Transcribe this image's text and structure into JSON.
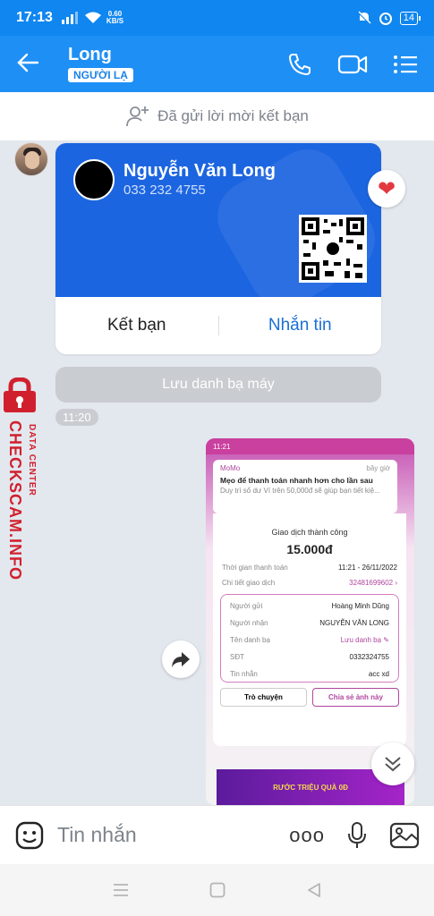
{
  "status": {
    "time": "17:13",
    "speed_value": "0.60",
    "speed_unit": "KB/S",
    "battery": "14"
  },
  "header": {
    "title": "Long",
    "badge": "NGƯỜI LẠ"
  },
  "friend_request": {
    "text": "Đã gửi lời mời kết bạn"
  },
  "contact_card": {
    "name": "Nguyễn Văn Long",
    "phone": "033 232 4755",
    "add_friend_label": "Kết bạn",
    "message_label": "Nhắn tin"
  },
  "save_contact": {
    "label": "Lưu danh bạ máy"
  },
  "message_time": "11:20",
  "watermark": {
    "line1": "DATA CENTER",
    "line2": "CHECKSCAM.INFO"
  },
  "screenshot": {
    "status_time": "11:21",
    "app_name": "MoMo",
    "notif_time": "bây giờ",
    "notif_title": "Mẹo để thanh toán nhanh hơn cho lần sau",
    "notif_desc": "Duy trì số dư Ví trên 50,000đ sẽ giúp bạn tiết kiệ...",
    "success_text": "Giao dịch thành công",
    "amount": "15.000đ",
    "rows": [
      {
        "label": "Thời gian thanh toán",
        "value": "11:21 - 26/11/2022"
      },
      {
        "label": "Chi tiết giao dịch",
        "value": "32481699602 ›"
      }
    ],
    "details": [
      {
        "label": "Người gửi",
        "value": "Hoàng Minh Dũng"
      },
      {
        "label": "Người nhận",
        "value": "NGUYỄN VĂN LONG"
      },
      {
        "label": "Tên danh bạ",
        "value": "Lưu danh bạ ✎"
      },
      {
        "label": "SĐT",
        "value": "0332324755"
      },
      {
        "label": "Tin nhắn",
        "value": "acc xd"
      }
    ],
    "btn_chat": "Trò chuyện",
    "btn_share": "Chia sẻ ảnh này",
    "banner_text": "RƯỚC TRIỆU QUÀ 0Đ"
  },
  "input": {
    "placeholder": "Tin nhắn",
    "more_label": "ooo"
  },
  "colors": {
    "primary": "#1e8ff5",
    "card": "#1c65e0",
    "watermark": "#d1202d",
    "momo": "#b0469e"
  }
}
